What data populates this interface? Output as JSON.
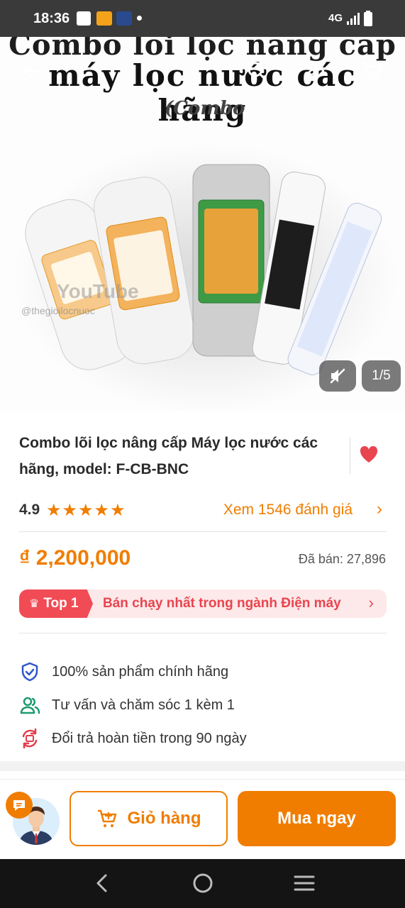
{
  "status_bar": {
    "time": "18:36",
    "network": "4G",
    "icons": [
      "message-icon",
      "shopee-icon",
      "app-icon",
      "dot-icon",
      "signal-icon",
      "battery-icon"
    ]
  },
  "hero": {
    "image_text_line1": "Combo lõi lọc nâng cấp",
    "image_text_line2": "máy lọc nước các hãng",
    "image_text_combo": "(Combo",
    "watermark": "YouTube",
    "watermark_handle": "@thegioilocnuoc",
    "image_counter": "1/5"
  },
  "product": {
    "title": "Combo lõi lọc nâng cấp Máy lọc nước các hãng, model: F-CB-BNC",
    "rating": "4.9",
    "stars": "★★★★★",
    "review_link": "Xem 1546 đánh giá",
    "price": "₫ 2,200,000",
    "sold": "Đã bán: 27,896"
  },
  "top_badge": {
    "label": "Top 1",
    "text": "Bán chạy nhất trong ngành Điện máy"
  },
  "features": [
    {
      "text": "100% sản phẩm chính hãng",
      "icon": "shield-check-icon"
    },
    {
      "text": "Tư vấn và chăm sóc 1 kèm 1",
      "icon": "users-icon"
    },
    {
      "text": "Đổi trả hoàn tiền trong 90 ngày",
      "icon": "refund-icon"
    }
  ],
  "actions": {
    "cart_label": "Giỏ hàng",
    "buy_label": "Mua ngay"
  },
  "colors": {
    "accent": "#f07d00",
    "top_red": "#f14b55",
    "top_bg": "#fde9ea",
    "shield_blue": "#2f57c9",
    "users_green": "#1a9b6c",
    "refund_red": "#e23c4b"
  }
}
